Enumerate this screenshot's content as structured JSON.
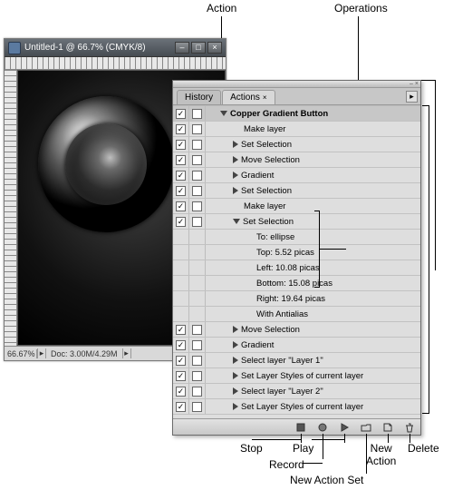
{
  "callouts": {
    "action": "Action",
    "operations": "Operations",
    "stop": "Stop",
    "record": "Record",
    "play": "Play",
    "new_action_set": "New Action Set",
    "new_action": "New\nAction",
    "delete": "Delete"
  },
  "doc_window": {
    "title": "Untitled-1 @ 66.7% (CMYK/8)",
    "zoom": "66.67%",
    "status": "Doc: 3.00M/4.29M"
  },
  "panel": {
    "tabs": {
      "history": "History",
      "actions": "Actions"
    },
    "header": "Copper Gradient Button",
    "rows": [
      {
        "check": true,
        "dlg": false,
        "indent": 2,
        "tw": "",
        "label": "Make layer"
      },
      {
        "check": true,
        "dlg": false,
        "indent": 2,
        "tw": "closed",
        "label": "Set Selection"
      },
      {
        "check": true,
        "dlg": false,
        "indent": 2,
        "tw": "closed",
        "label": "Move Selection"
      },
      {
        "check": true,
        "dlg": false,
        "indent": 2,
        "tw": "closed",
        "label": "Gradient"
      },
      {
        "check": true,
        "dlg": false,
        "indent": 2,
        "tw": "closed",
        "label": "Set Selection"
      },
      {
        "check": true,
        "dlg": false,
        "indent": 2,
        "tw": "",
        "label": "Make layer"
      },
      {
        "check": true,
        "dlg": false,
        "indent": 2,
        "tw": "open",
        "label": "Set Selection"
      },
      {
        "check": null,
        "dlg": null,
        "indent": 3,
        "tw": "",
        "label": "To: ellipse"
      },
      {
        "check": null,
        "dlg": null,
        "indent": 3,
        "tw": "",
        "label": "Top: 5.52 picas"
      },
      {
        "check": null,
        "dlg": null,
        "indent": 3,
        "tw": "",
        "label": "Left: 10.08 picas"
      },
      {
        "check": null,
        "dlg": null,
        "indent": 3,
        "tw": "",
        "label": "Bottom: 15.08 picas"
      },
      {
        "check": null,
        "dlg": null,
        "indent": 3,
        "tw": "",
        "label": "Right: 19.64 picas"
      },
      {
        "check": null,
        "dlg": null,
        "indent": 3,
        "tw": "",
        "label": "With Antialias"
      },
      {
        "check": true,
        "dlg": false,
        "indent": 2,
        "tw": "closed",
        "label": "Move Selection"
      },
      {
        "check": true,
        "dlg": false,
        "indent": 2,
        "tw": "closed",
        "label": "Gradient"
      },
      {
        "check": true,
        "dlg": false,
        "indent": 2,
        "tw": "closed",
        "label": "Select layer \"Layer 1\""
      },
      {
        "check": true,
        "dlg": false,
        "indent": 2,
        "tw": "closed",
        "label": "Set Layer Styles of current layer"
      },
      {
        "check": true,
        "dlg": false,
        "indent": 2,
        "tw": "closed",
        "label": "Select layer \"Layer 2\""
      },
      {
        "check": true,
        "dlg": false,
        "indent": 2,
        "tw": "closed",
        "label": "Set Layer Styles of current layer"
      }
    ]
  }
}
